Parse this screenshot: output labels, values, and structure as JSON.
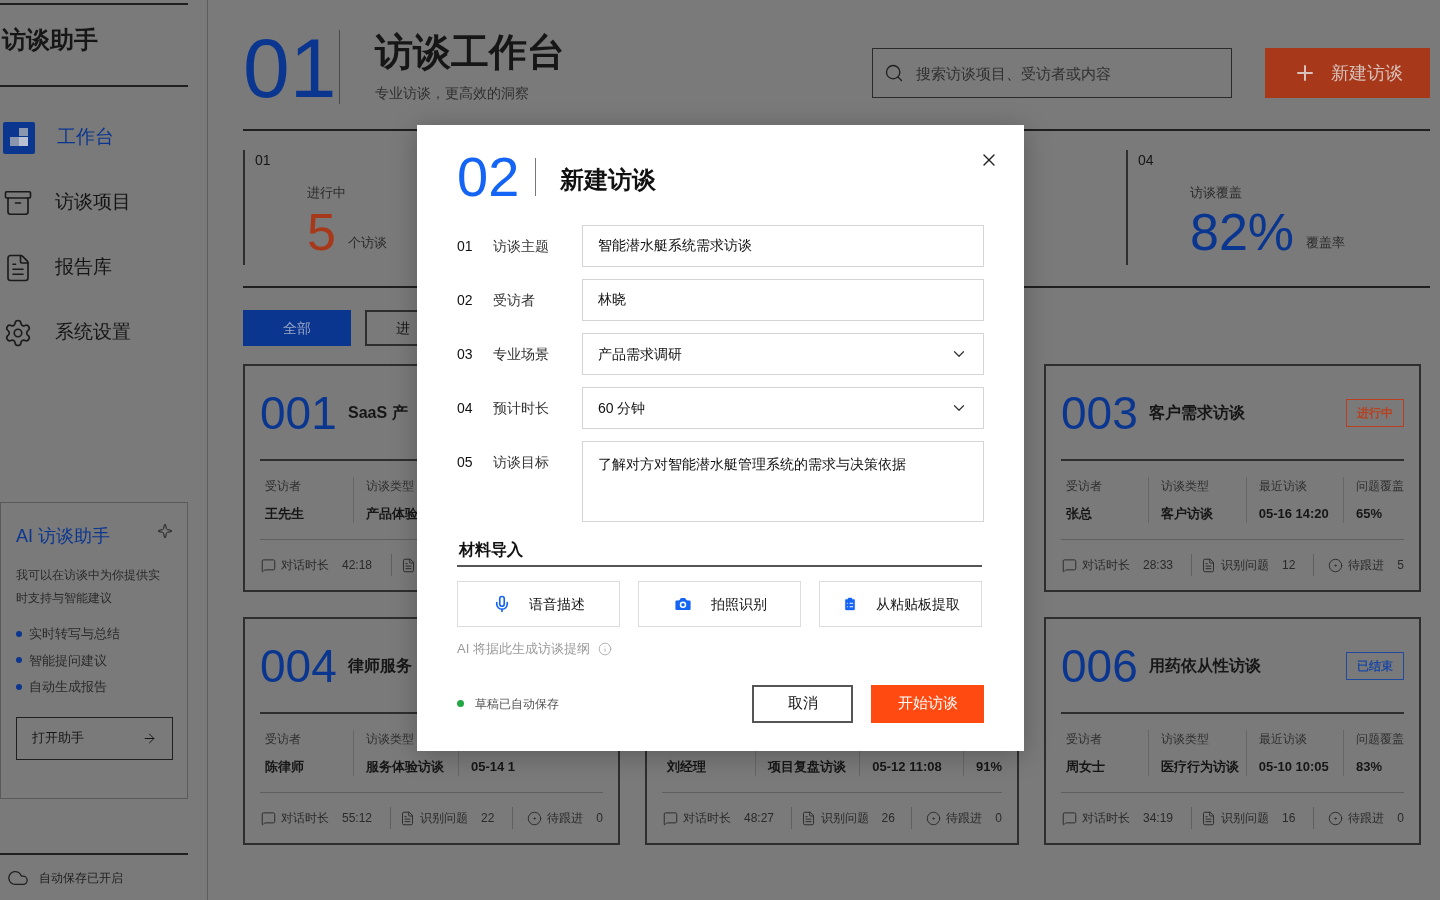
{
  "sidebar": {
    "title": "访谈助手",
    "nav": [
      {
        "label": "工作台",
        "selected": true
      },
      {
        "label": "访谈项目",
        "selected": false
      },
      {
        "label": "报告库",
        "selected": false
      },
      {
        "label": "系统设置",
        "selected": false
      }
    ],
    "assistant": {
      "title": "AI 访谈助手",
      "description": "我可以在访谈中为你提供实时支持与智能建议",
      "features": [
        "实时转写与总结",
        "智能提问建议",
        "自动生成报告"
      ],
      "button": "打开助手"
    },
    "status": "自动保存已开启"
  },
  "header": {
    "number": "01",
    "title": "访谈工作台",
    "subtitle": "专业访谈，更高效的洞察",
    "search": {
      "placeholder": "搜索访谈项目、受访者或内容"
    },
    "new_button": "新建访谈"
  },
  "stats": [
    {
      "index": "01",
      "label": "进行中",
      "value": "5",
      "unit": "个访谈",
      "color": "#a8381a"
    },
    {
      "index": "04",
      "label": "访谈覆盖",
      "value": "82%",
      "unit": "覆盖率",
      "color": "#0b3690"
    }
  ],
  "filters": [
    {
      "label": "全部",
      "selected": true
    },
    {
      "label": "进",
      "selected": false
    }
  ],
  "card_columns": [
    [
      {
        "number": "001",
        "title": "SaaS 产",
        "fields": [
          {
            "label": "受访者",
            "value": "王先生"
          },
          {
            "label": "访谈类型",
            "value": "产品体验"
          }
        ],
        "footer": [
          {
            "kind": "duration",
            "label": "对话时长",
            "value": "42:18"
          },
          {
            "kind": "issues"
          }
        ]
      },
      {
        "number": "004",
        "title": "律师服务",
        "fields": [
          {
            "label": "受访者",
            "value": "陈律师"
          },
          {
            "label": "访谈类型",
            "value": "服务体验访谈"
          },
          {
            "value": "05-14 1"
          }
        ],
        "footer": [
          {
            "kind": "duration",
            "label": "对话时长",
            "value": "55:12"
          },
          {
            "kind": "issues",
            "label": "识别问题",
            "value": "22"
          },
          {
            "kind": "followup",
            "label": "待跟进",
            "value": "0"
          }
        ]
      }
    ],
    [
      {
        "fields": [
          {
            "value": "刘经理"
          },
          {
            "value": "项目复盘访谈"
          },
          {
            "value": "05-12 11:08"
          },
          {
            "value": "91%"
          }
        ],
        "footer": [
          {
            "kind": "duration",
            "label": "对话时长",
            "value": "48:27"
          },
          {
            "kind": "issues",
            "label": "识别问题",
            "value": "26"
          },
          {
            "kind": "followup",
            "label": "待跟进",
            "value": "0"
          }
        ]
      }
    ],
    [
      {
        "number": "003",
        "title": "客户需求访谈",
        "badge": {
          "label": "进行中",
          "color": "#b8401f"
        },
        "fields": [
          {
            "label": "受访者",
            "value": "张总"
          },
          {
            "label": "访谈类型",
            "value": "客户访谈"
          },
          {
            "label": "最近访谈",
            "value": "05-16 14:20"
          },
          {
            "label": "问题覆盖",
            "value": "65%"
          }
        ],
        "footer": [
          {
            "kind": "duration",
            "label": "对话时长",
            "value": "28:33"
          },
          {
            "kind": "issues",
            "label": "识别问题",
            "value": "12"
          },
          {
            "kind": "followup",
            "label": "待跟进",
            "value": "5"
          }
        ]
      },
      {
        "number": "006",
        "title": "用药依从性访谈",
        "badge": {
          "label": "已结束",
          "color": "#1f4aa0"
        },
        "fields": [
          {
            "label": "受访者",
            "value": "周女士"
          },
          {
            "label": "访谈类型",
            "value": "医疗行为访谈"
          },
          {
            "label": "最近访谈",
            "value": "05-10 10:05"
          },
          {
            "label": "问题覆盖",
            "value": "83%"
          }
        ],
        "footer": [
          {
            "kind": "duration",
            "label": "对话时长",
            "value": "34:19"
          },
          {
            "kind": "issues",
            "label": "识别问题",
            "value": "16"
          },
          {
            "kind": "followup",
            "label": "待跟进",
            "value": "0"
          }
        ]
      }
    ]
  ],
  "dialog": {
    "number": "02",
    "title": "新建访谈",
    "fields": [
      {
        "index": "01",
        "label": "访谈主题",
        "kind": "text",
        "value": "智能潜水艇系统需求访谈"
      },
      {
        "index": "02",
        "label": "受访者",
        "kind": "text",
        "value": "林晓"
      },
      {
        "index": "03",
        "label": "专业场景",
        "kind": "select",
        "value": "产品需求调研"
      },
      {
        "index": "04",
        "label": "预计时长",
        "kind": "select",
        "value": "60 分钟"
      },
      {
        "index": "05",
        "label": "访谈目标",
        "kind": "textarea",
        "value": "了解对方对智能潜水艇管理系统的需求与决策依据"
      }
    ],
    "materials_title": "材料导入",
    "materials": [
      {
        "kind": "voice",
        "label": "语音描述"
      },
      {
        "kind": "photo",
        "label": "拍照识别"
      },
      {
        "kind": "clipboard",
        "label": "从粘贴板提取"
      }
    ],
    "hint": "AI 将据此生成访谈提纲",
    "draft_status": "草稿已自动保存",
    "cancel": "取消",
    "submit": "开始访谈"
  }
}
